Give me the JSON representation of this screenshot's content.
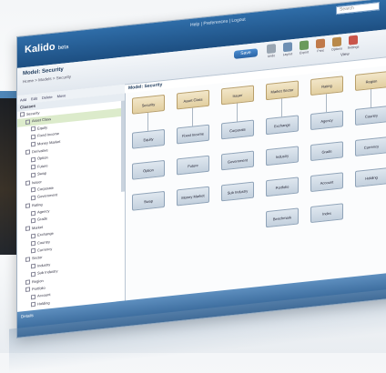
{
  "app": {
    "logo": "Kalido",
    "logo_sub": "beta",
    "user_links": "Help | Preferences | Logout",
    "search_placeholder": "Search"
  },
  "header": {
    "page_title": "Model: Security",
    "breadcrumb": "Home > Models > Security",
    "action_label": "Save",
    "view_label": "View"
  },
  "toolbar": {
    "tools": [
      {
        "label": "Undo",
        "color": "#9aa6b2"
      },
      {
        "label": "Layout",
        "color": "#6d8fb3"
      },
      {
        "label": "Export",
        "color": "#6a9a5b"
      },
      {
        "label": "Print",
        "color": "#c07a4a"
      },
      {
        "label": "Options",
        "color": "#b9894a"
      },
      {
        "label": "Settings",
        "color": "#c9554a"
      }
    ]
  },
  "tree_toolbar": {
    "items": [
      "Add",
      "Edit",
      "Delete",
      "Move"
    ]
  },
  "tree": {
    "header": "Classes",
    "rows": [
      {
        "label": "Security",
        "level": 0,
        "selected": false
      },
      {
        "label": "Asset Class",
        "level": 1,
        "selected": true
      },
      {
        "label": "Equity",
        "level": 2,
        "selected": false
      },
      {
        "label": "Fixed Income",
        "level": 2,
        "selected": false
      },
      {
        "label": "Money Market",
        "level": 2,
        "selected": false
      },
      {
        "label": "Derivative",
        "level": 1,
        "selected": false
      },
      {
        "label": "Option",
        "level": 2,
        "selected": false
      },
      {
        "label": "Future",
        "level": 2,
        "selected": false
      },
      {
        "label": "Swap",
        "level": 2,
        "selected": false
      },
      {
        "label": "Issuer",
        "level": 1,
        "selected": false
      },
      {
        "label": "Corporate",
        "level": 2,
        "selected": false
      },
      {
        "label": "Government",
        "level": 2,
        "selected": false
      },
      {
        "label": "Rating",
        "level": 1,
        "selected": false
      },
      {
        "label": "Agency",
        "level": 2,
        "selected": false
      },
      {
        "label": "Grade",
        "level": 2,
        "selected": false
      },
      {
        "label": "Market",
        "level": 1,
        "selected": false
      },
      {
        "label": "Exchange",
        "level": 2,
        "selected": false
      },
      {
        "label": "Country",
        "level": 2,
        "selected": false
      },
      {
        "label": "Currency",
        "level": 2,
        "selected": false
      },
      {
        "label": "Sector",
        "level": 1,
        "selected": false
      },
      {
        "label": "Industry",
        "level": 2,
        "selected": false
      },
      {
        "label": "Sub Industry",
        "level": 2,
        "selected": false
      },
      {
        "label": "Region",
        "level": 1,
        "selected": false
      },
      {
        "label": "Portfolio",
        "level": 1,
        "selected": false
      },
      {
        "label": "Account",
        "level": 2,
        "selected": false
      },
      {
        "label": "Holding",
        "level": 2,
        "selected": false
      }
    ]
  },
  "diagram": {
    "title": "Model: Security",
    "nodes": [
      {
        "label": "Security",
        "kind": "hdr"
      },
      {
        "label": "Asset Class",
        "kind": "hdr"
      },
      {
        "label": "Issuer",
        "kind": "hdr"
      },
      {
        "label": "Market Sector",
        "kind": "hdr"
      },
      {
        "label": "Rating",
        "kind": "hdr"
      },
      {
        "label": "Region",
        "kind": "hdr"
      },
      {
        "label": "Equity",
        "kind": "n"
      },
      {
        "label": "Fixed Income",
        "kind": "n"
      },
      {
        "label": "Corporate",
        "kind": "n"
      },
      {
        "label": "Exchange",
        "kind": "n"
      },
      {
        "label": "Agency",
        "kind": "n"
      },
      {
        "label": "Country",
        "kind": "n"
      },
      {
        "label": "Option",
        "kind": "n"
      },
      {
        "label": "Future",
        "kind": "n"
      },
      {
        "label": "Government",
        "kind": "n"
      },
      {
        "label": "Industry",
        "kind": "n"
      },
      {
        "label": "Grade",
        "kind": "n"
      },
      {
        "label": "Currency",
        "kind": "n"
      },
      {
        "label": "Swap",
        "kind": "n"
      },
      {
        "label": "Money Market",
        "kind": "n"
      },
      {
        "label": "Sub Industry",
        "kind": "n"
      },
      {
        "label": "Portfolio",
        "kind": "n"
      },
      {
        "label": "Account",
        "kind": "n"
      },
      {
        "label": "Holding",
        "kind": "n"
      },
      {
        "label": "Benchmark",
        "kind": "n"
      },
      {
        "label": "Index",
        "kind": "n"
      }
    ]
  },
  "footer": {
    "label": "Details"
  }
}
